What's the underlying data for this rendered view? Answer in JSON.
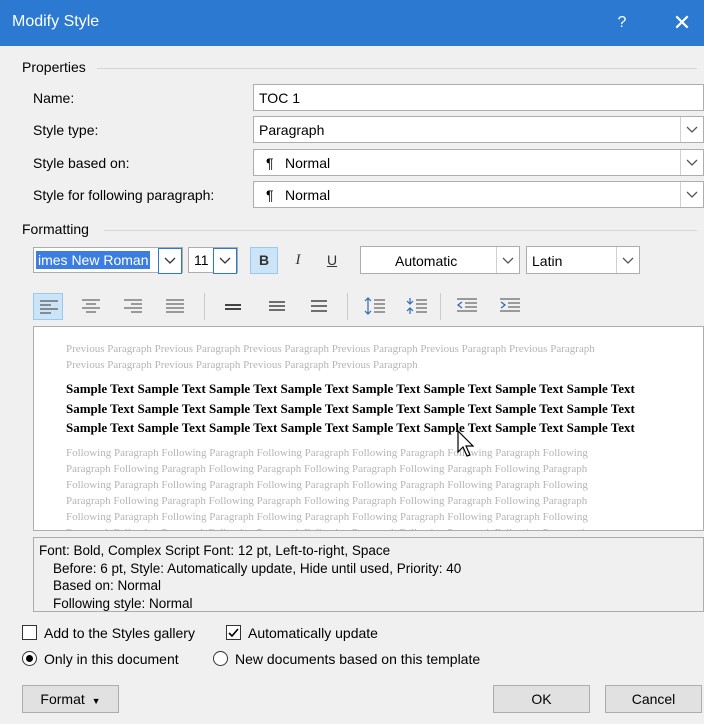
{
  "dialog": {
    "title": "Modify Style",
    "help_label": "?",
    "close_label": "✕"
  },
  "properties": {
    "section_label": "Properties",
    "name_label": "Name:",
    "name_value": "TOC 1",
    "style_type_label": "Style type:",
    "style_type_value": "Paragraph",
    "based_on_label": "Style based on:",
    "based_on_value": "Normal",
    "following_label": "Style for following paragraph:",
    "following_value": "Normal",
    "pilcrow": "¶"
  },
  "formatting": {
    "section_label": "Formatting",
    "font_name": "imes New Roman",
    "font_size": "11",
    "bold_label": "B",
    "italic_label": "I",
    "underline_label": "U",
    "color_value": "Automatic",
    "script_value": "Latin"
  },
  "preview": {
    "previous_text": "Previous Paragraph Previous Paragraph Previous Paragraph Previous Paragraph Previous Paragraph Previous Paragraph Previous Paragraph Previous Paragraph Previous Paragraph Previous Paragraph",
    "sample_text": "Sample Text Sample Text Sample Text Sample Text Sample Text Sample Text Sample Text Sample Text Sample Text Sample Text Sample Text Sample Text Sample Text Sample Text Sample Text Sample Text Sample Text Sample Text Sample Text Sample Text Sample Text Sample Text Sample Text Sample Text",
    "following_text": "Following Paragraph Following Paragraph Following Paragraph Following Paragraph Following Paragraph Following Paragraph Following Paragraph Following Paragraph Following Paragraph Following Paragraph Following Paragraph Following Paragraph Following Paragraph Following Paragraph Following Paragraph Following Paragraph Following Paragraph Following Paragraph Following Paragraph Following Paragraph Following Paragraph Following Paragraph Following Paragraph Following Paragraph Following Paragraph Following Paragraph Following Paragraph Following Paragraph Following Paragraph Following Paragraph Following Paragraph Following Paragraph Following Paragraph Following Paragraph Following Paragraph"
  },
  "description": {
    "line1": "Font: Bold, Complex Script Font: 12 pt, Left-to-right, Space",
    "line2": "Before:  6 pt, Style: Automatically update, Hide until used, Priority: 40",
    "line3": "Based on: Normal",
    "line4": "Following style: Normal"
  },
  "options": {
    "add_to_gallery_label": "Add to the Styles gallery",
    "add_to_gallery_checked": false,
    "auto_update_label": "Automatically update",
    "auto_update_checked": true,
    "only_this_doc_label": "Only in this document",
    "new_docs_label": "New documents based on this template",
    "selected_scope": "only_this_doc"
  },
  "buttons": {
    "format_label": "Format",
    "ok_label": "OK",
    "cancel_label": "Cancel"
  },
  "colors": {
    "titlebar": "#2b79d0",
    "selection": "#3b7de0",
    "active_toggle": "#cce4f7"
  }
}
